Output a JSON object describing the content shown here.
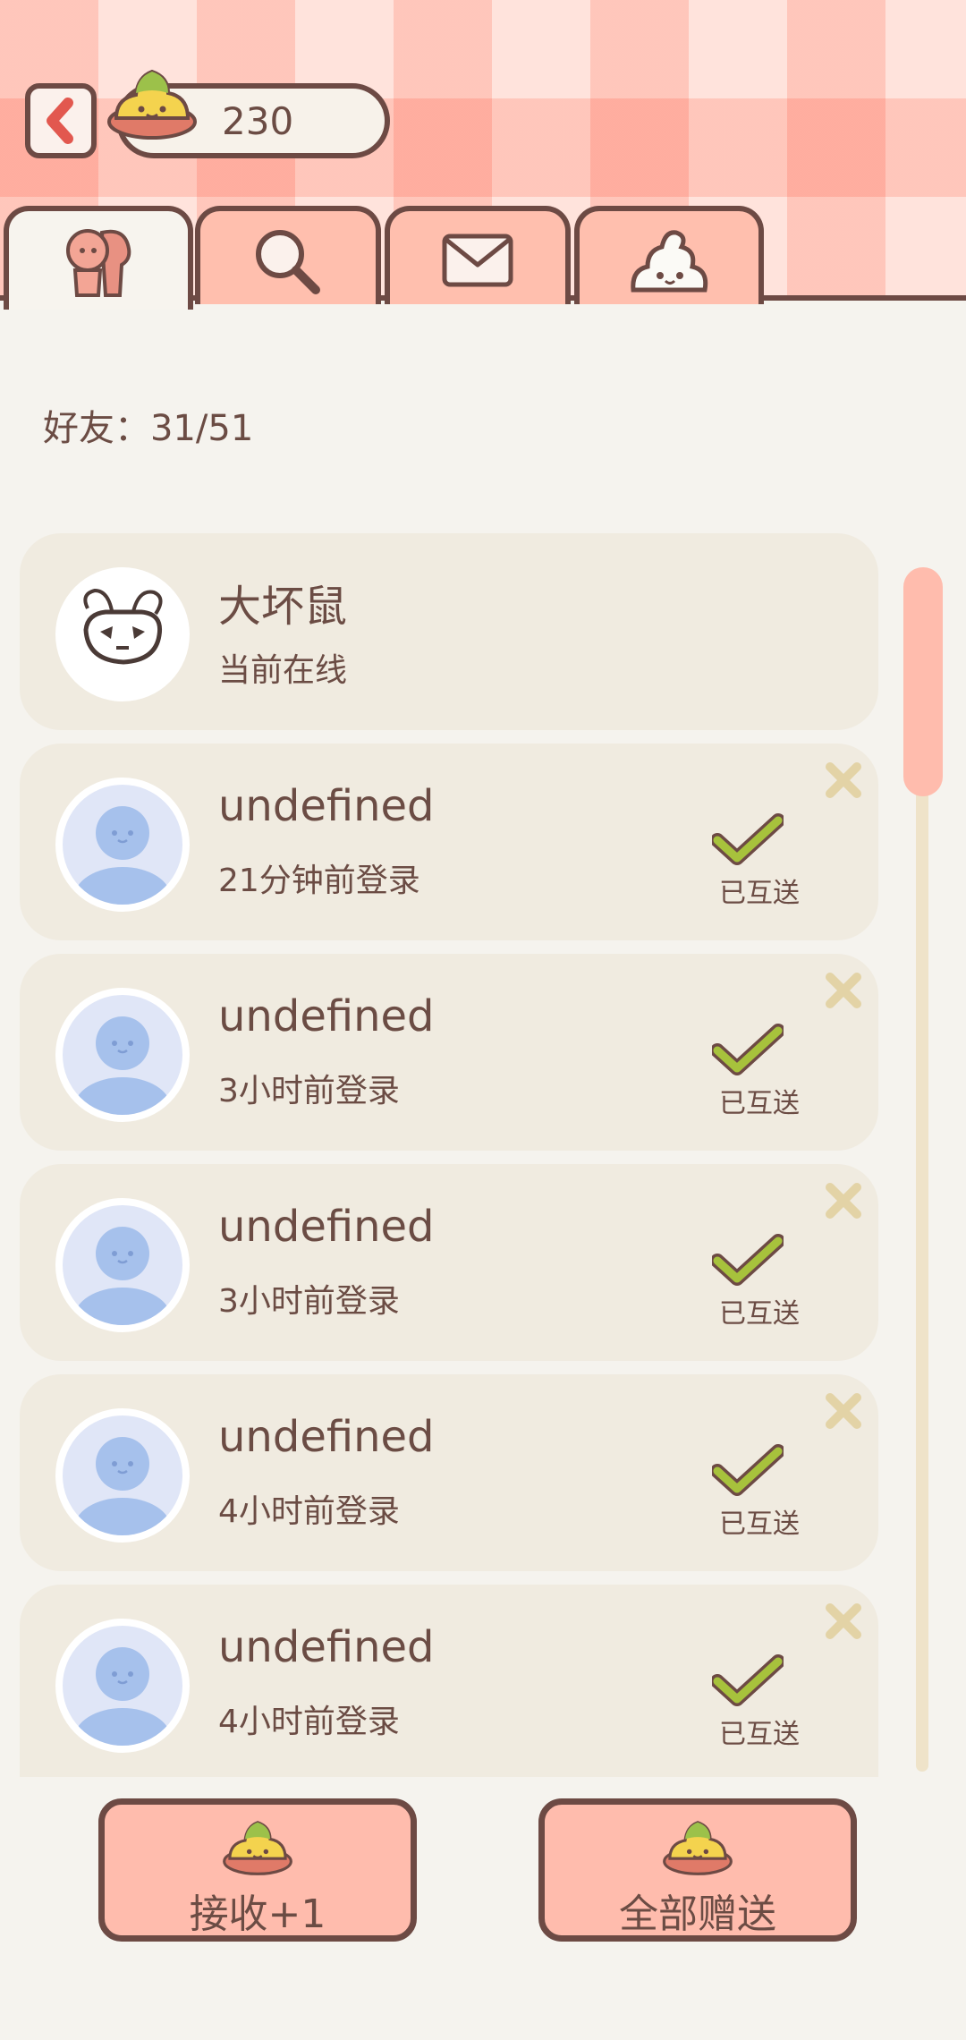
{
  "header": {
    "coins": "230"
  },
  "tabs": [
    {
      "id": "friends",
      "icon": "friends-icon",
      "active": true
    },
    {
      "id": "search",
      "icon": "search-icon",
      "active": false
    },
    {
      "id": "mail",
      "icon": "mail-icon",
      "active": false
    },
    {
      "id": "poop",
      "icon": "poop-icon",
      "active": false
    }
  ],
  "friends": {
    "count_label": "好友：31/51",
    "items": [
      {
        "name": "大坏鼠",
        "status": "当前在线",
        "sent": ""
      },
      {
        "name": "undefined",
        "status": "21分钟前登录",
        "sent": "已互送"
      },
      {
        "name": "undefined",
        "status": "3小时前登录",
        "sent": "已互送"
      },
      {
        "name": "undefined",
        "status": "3小时前登录",
        "sent": "已互送"
      },
      {
        "name": "undefined",
        "status": "4小时前登录",
        "sent": "已互送"
      },
      {
        "name": "undefined",
        "status": "4小时前登录",
        "sent": "已互送"
      }
    ]
  },
  "buttons": {
    "receive": "接收+1",
    "send_all": "全部赠送"
  },
  "colors": {
    "accent": "#ffbcad",
    "check": "#a7c23c",
    "outline": "#6d4a44",
    "card": "#f0ebe0"
  }
}
